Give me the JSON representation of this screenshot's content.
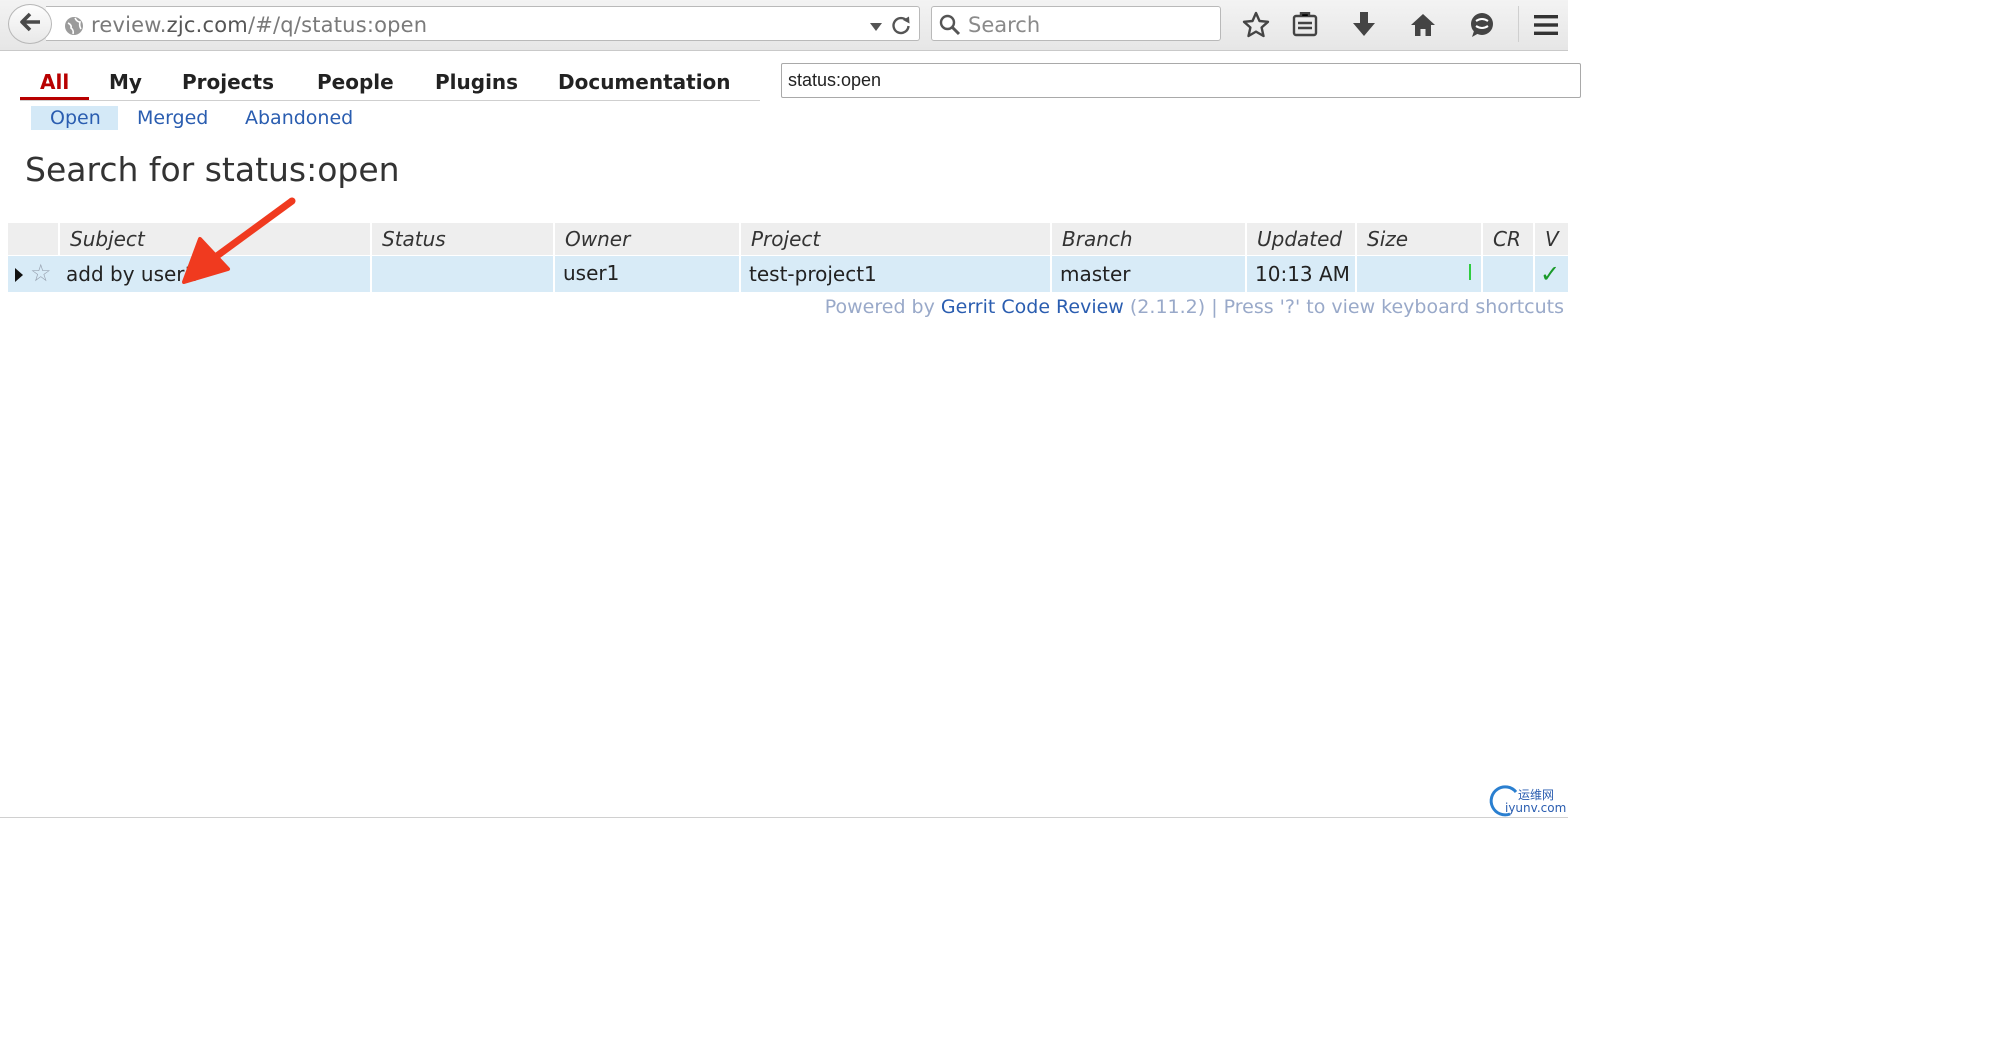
{
  "browser": {
    "url_prefix": "review.",
    "url_host": "zjc.com",
    "url_path": "/#/q/status:open",
    "search_placeholder": "Search",
    "icons": [
      "back-icon",
      "globe-icon",
      "dropdown-icon",
      "reload-icon",
      "search-icon",
      "bookmark-star-icon",
      "reading-list-icon",
      "download-icon",
      "home-icon",
      "chat-icon",
      "menu-icon"
    ]
  },
  "gerrit": {
    "menu": [
      {
        "label": "All",
        "active": true
      },
      {
        "label": "My",
        "active": false
      },
      {
        "label": "Projects",
        "active": false
      },
      {
        "label": "People",
        "active": false
      },
      {
        "label": "Plugins",
        "active": false
      },
      {
        "label": "Documentation",
        "active": false
      }
    ],
    "query_value": "status:open",
    "submenu": [
      {
        "label": "Open",
        "active": true
      },
      {
        "label": "Merged",
        "active": false
      },
      {
        "label": "Abandoned",
        "active": false
      }
    ],
    "page_title": "Search for status:open",
    "columns": [
      "Subject",
      "Status",
      "Owner",
      "Project",
      "Branch",
      "Updated",
      "Size",
      "CR",
      "V"
    ],
    "rows": [
      {
        "subject": "add by user1",
        "status": "",
        "owner": "user1",
        "project": "test-project1",
        "branch": "master",
        "updated": "10:13 AM",
        "cr": "",
        "v": "✓",
        "starred": false
      }
    ],
    "footer": {
      "powered_by": "Powered by ",
      "link": "Gerrit Code Review",
      "version_and_hint": " (2.11.2) | Press '?' to view keyboard shortcuts"
    }
  },
  "colors": {
    "active_tab": "#b80000",
    "link": "#2a5db0",
    "row_highlight": "#d8ebf7",
    "annotation_arrow": "#f03a1f",
    "verified_check": "#1a9a2a"
  },
  "watermark": {
    "line1": "运维网",
    "line2": "iyunv.com"
  }
}
